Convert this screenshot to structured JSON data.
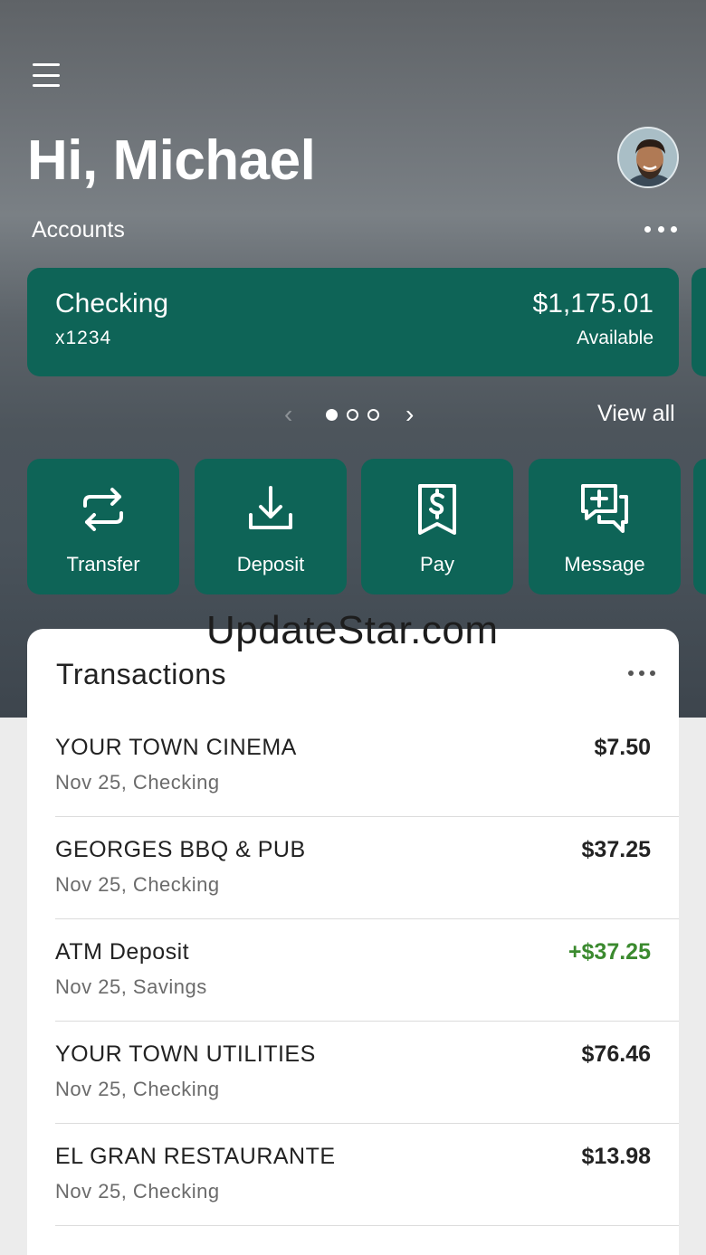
{
  "header": {
    "menu_icon": "hamburger-menu-icon",
    "greeting": "Hi, Michael",
    "avatar_icon": "user-avatar"
  },
  "accounts": {
    "label": "Accounts",
    "more_icon": "more-dots-icon",
    "card": {
      "name": "Checking",
      "number": "x1234",
      "balance": "$1,175.01",
      "balance_label": "Available"
    },
    "pager": {
      "total": 3,
      "active": 1
    },
    "view_all": "View all"
  },
  "actions": [
    {
      "label": "Transfer",
      "icon": "transfer-arrows-icon"
    },
    {
      "label": "Deposit",
      "icon": "download-tray-icon"
    },
    {
      "label": "Pay",
      "icon": "bill-dollar-icon"
    },
    {
      "label": "Message",
      "icon": "message-plus-icon"
    }
  ],
  "watermark": "UpdateStar.com",
  "transactions": {
    "title": "Transactions",
    "items": [
      {
        "merchant": "YOUR TOWN CINEMA",
        "meta": "Nov 25, Checking",
        "amount": "$7.50",
        "credit": false
      },
      {
        "merchant": "GEORGES BBQ & PUB",
        "meta": "Nov 25, Checking",
        "amount": "$37.25",
        "credit": false
      },
      {
        "merchant": "ATM Deposit",
        "meta": "Nov 25, Savings",
        "amount": "+$37.25",
        "credit": true
      },
      {
        "merchant": "YOUR TOWN UTILITIES",
        "meta": "Nov 25, Checking",
        "amount": "$76.46",
        "credit": false
      },
      {
        "merchant": "EL GRAN RESTAURANTE",
        "meta": "Nov 25, Checking",
        "amount": "$13.98",
        "credit": false
      }
    ]
  },
  "colors": {
    "card_green": "#0e6457",
    "credit_green": "#3b8a2f"
  }
}
